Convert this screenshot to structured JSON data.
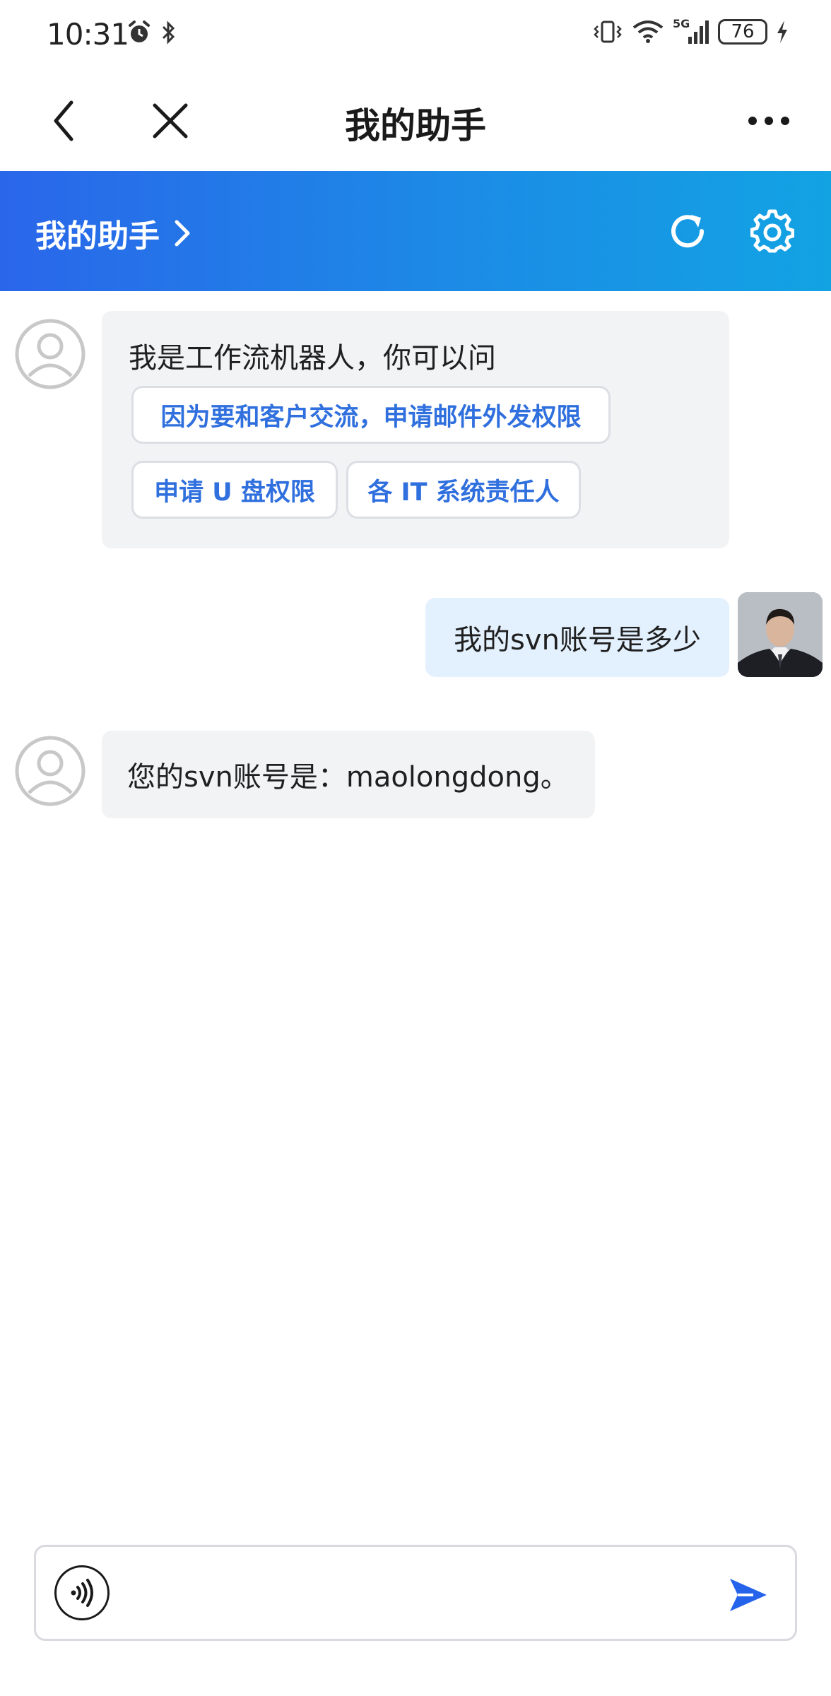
{
  "status_bar": {
    "time": "10:31",
    "left_icons": [
      "alarm-icon",
      "bluetooth-icon"
    ],
    "right_icons": [
      "vibrate-icon",
      "wifi-icon",
      "5g-signal-icon",
      "battery-icon",
      "charging-icon"
    ],
    "network": "5G",
    "battery": "76"
  },
  "nav": {
    "title": "我的助手",
    "back_icon": "chevron-left-icon",
    "close_icon": "close-icon",
    "more_icon": "more-dots-icon"
  },
  "assistant_header": {
    "title": "我的助手",
    "arrow_icon": "chevron-right-icon",
    "refresh_icon": "refresh-icon",
    "settings_icon": "gear-icon",
    "gradient_start": "#2a66ea",
    "gradient_end": "#12a3e3"
  },
  "messages": [
    {
      "role": "bot",
      "text": "我是工作流机器人，你可以问",
      "suggestions": [
        "因为要和客户交流，申请邮件外发权限",
        "申请 U 盘权限",
        "各 IT 系统责任人"
      ]
    },
    {
      "role": "user",
      "text": "我的svn账号是多少"
    },
    {
      "role": "bot",
      "text": "您的svn账号是：maolongdong。"
    }
  ],
  "input": {
    "value": "",
    "placeholder": "",
    "voice_icon": "voice-icon",
    "send_icon": "send-icon"
  },
  "colors": {
    "accent": "#2f6fde",
    "bot_bubble": "#f2f3f5",
    "user_bubble": "#e3f0fd"
  }
}
